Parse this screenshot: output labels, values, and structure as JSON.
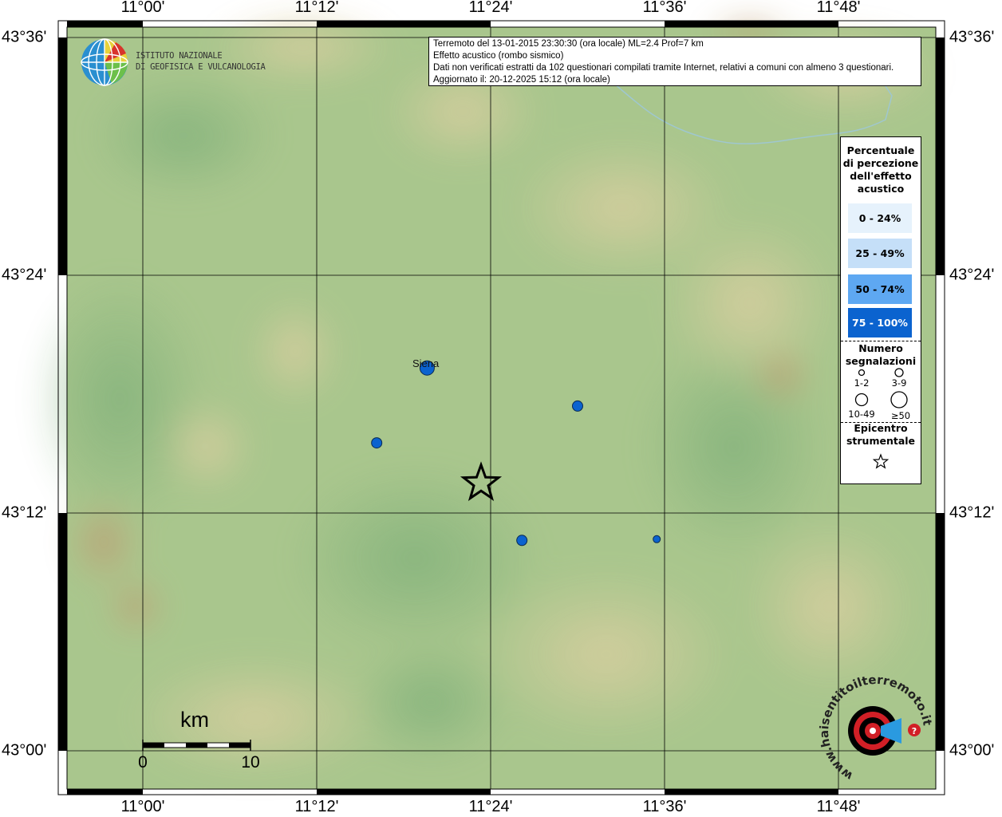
{
  "info": {
    "line1": "Terremoto del 13-01-2015 23:30:30 (ora locale) ML=2.4 Prof=7 km",
    "line2": "Effetto acustico (rombo sismico)",
    "line3": "Dati non verificati estratti da 102 questionari compilati tramite Internet, relativi a comuni con almeno 3 questionari.",
    "line4": "Aggiornato il: 20-12-2025 15:12 (ora locale)"
  },
  "institute": {
    "line1": "ISTITUTO NAZIONALE",
    "line2": "DI GEOFISICA E VULCANOLOGIA"
  },
  "axes": {
    "lon_ticks": [
      "11°00'",
      "11°12'",
      "11°24'",
      "11°36'",
      "11°48'"
    ],
    "lat_ticks": [
      "43°36'",
      "43°24'",
      "43°12'",
      "43°00'"
    ]
  },
  "legend": {
    "title": [
      "Percentuale",
      "di percezione",
      "dell'effetto",
      "acustico"
    ],
    "classes": [
      {
        "label": "0 - 24%",
        "color": "#e6f2fc"
      },
      {
        "label": "25 - 49%",
        "color": "#c5dff8"
      },
      {
        "label": "50 - 74%",
        "color": "#5ea8f2"
      },
      {
        "label": "75 - 100%",
        "color": "#0b63cf"
      }
    ],
    "count_title": [
      "Numero",
      "segnalazioni"
    ],
    "count_classes": [
      "1-2",
      "3-9",
      "10-49",
      "≥50"
    ],
    "epicenter_title": [
      "Epicentro",
      "strumentale"
    ]
  },
  "city": {
    "name": "Siena"
  },
  "scale": {
    "unit": "km",
    "start": "0",
    "end": "10"
  },
  "sites": [
    {
      "lat": 43.29,
      "lon": 11.5,
      "pct_class": 3,
      "count_class": 1
    },
    {
      "lat": 43.322,
      "lon": 11.327,
      "pct_class": 3,
      "count_class": 2
    },
    {
      "lat": 43.259,
      "lon": 11.269,
      "pct_class": 3,
      "count_class": 1
    },
    {
      "lat": 43.177,
      "lon": 11.436,
      "pct_class": 3,
      "count_class": 1
    },
    {
      "lat": 43.178,
      "lon": 11.591,
      "pct_class": 3,
      "count_class": 0
    }
  ],
  "epicenter": {
    "lat": 43.225,
    "lon": 11.389
  },
  "watermark": "www.haisentitoilterremoto.it"
}
